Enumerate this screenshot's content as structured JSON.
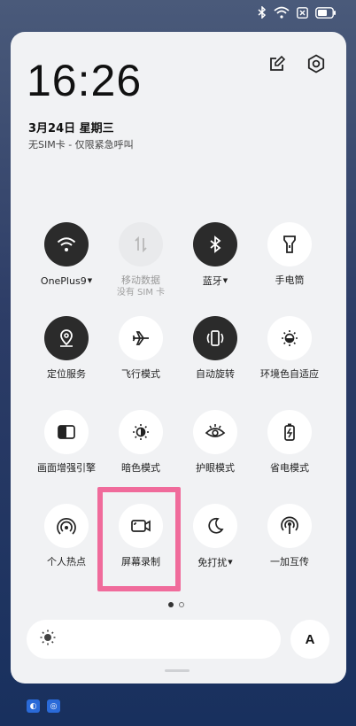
{
  "status_bar": {
    "icons": [
      "bluetooth-icon",
      "wifi-icon",
      "sim-icon",
      "battery-icon"
    ]
  },
  "header": {
    "icons": [
      "edit-icon",
      "settings-icon"
    ]
  },
  "clock": {
    "time": "16:26"
  },
  "date": {
    "text": "3月24日  星期三"
  },
  "sim_status": {
    "text": "无SIM卡 - 仅限紧急呼叫"
  },
  "tiles": [
    {
      "label": "OnePlus9",
      "caret": "▼",
      "icon": "wifi-icon",
      "state": "active"
    },
    {
      "label": "移动数据",
      "sub": "没有 SIM 卡",
      "icon": "mobile-data-icon",
      "state": "disabled"
    },
    {
      "label": "蓝牙",
      "caret": "▼",
      "icon": "bluetooth-icon",
      "state": "active"
    },
    {
      "label": "手电筒",
      "icon": "flashlight-icon",
      "state": "off"
    },
    {
      "label": "定位服务",
      "icon": "location-icon",
      "state": "active"
    },
    {
      "label": "飞行模式",
      "icon": "airplane-icon",
      "state": "off"
    },
    {
      "label": "自动旋转",
      "icon": "auto-rotate-icon",
      "state": "active"
    },
    {
      "label": "环境色自适应",
      "icon": "ambient-color-icon",
      "state": "off"
    },
    {
      "label": "画面增强引擎",
      "icon": "display-enhance-icon",
      "state": "off"
    },
    {
      "label": "暗色模式",
      "icon": "dark-mode-icon",
      "state": "off"
    },
    {
      "label": "护眼模式",
      "icon": "eye-comfort-icon",
      "state": "off"
    },
    {
      "label": "省电模式",
      "icon": "battery-saver-icon",
      "state": "off"
    },
    {
      "label": "个人热点",
      "icon": "hotspot-icon",
      "state": "off"
    },
    {
      "label": "屏幕录制",
      "icon": "screen-record-icon",
      "state": "off",
      "highlighted": true
    },
    {
      "label": "免打扰",
      "caret": "▼",
      "icon": "do-not-disturb-icon",
      "state": "off"
    },
    {
      "label": "一加互传",
      "icon": "oneplus-share-icon",
      "state": "off"
    }
  ],
  "pager": {
    "current": 1,
    "total": 2
  },
  "brightness": {
    "icon": "brightness-icon"
  },
  "auto_brightness": {
    "label": "A"
  },
  "highlight_color": "#f06b9b"
}
